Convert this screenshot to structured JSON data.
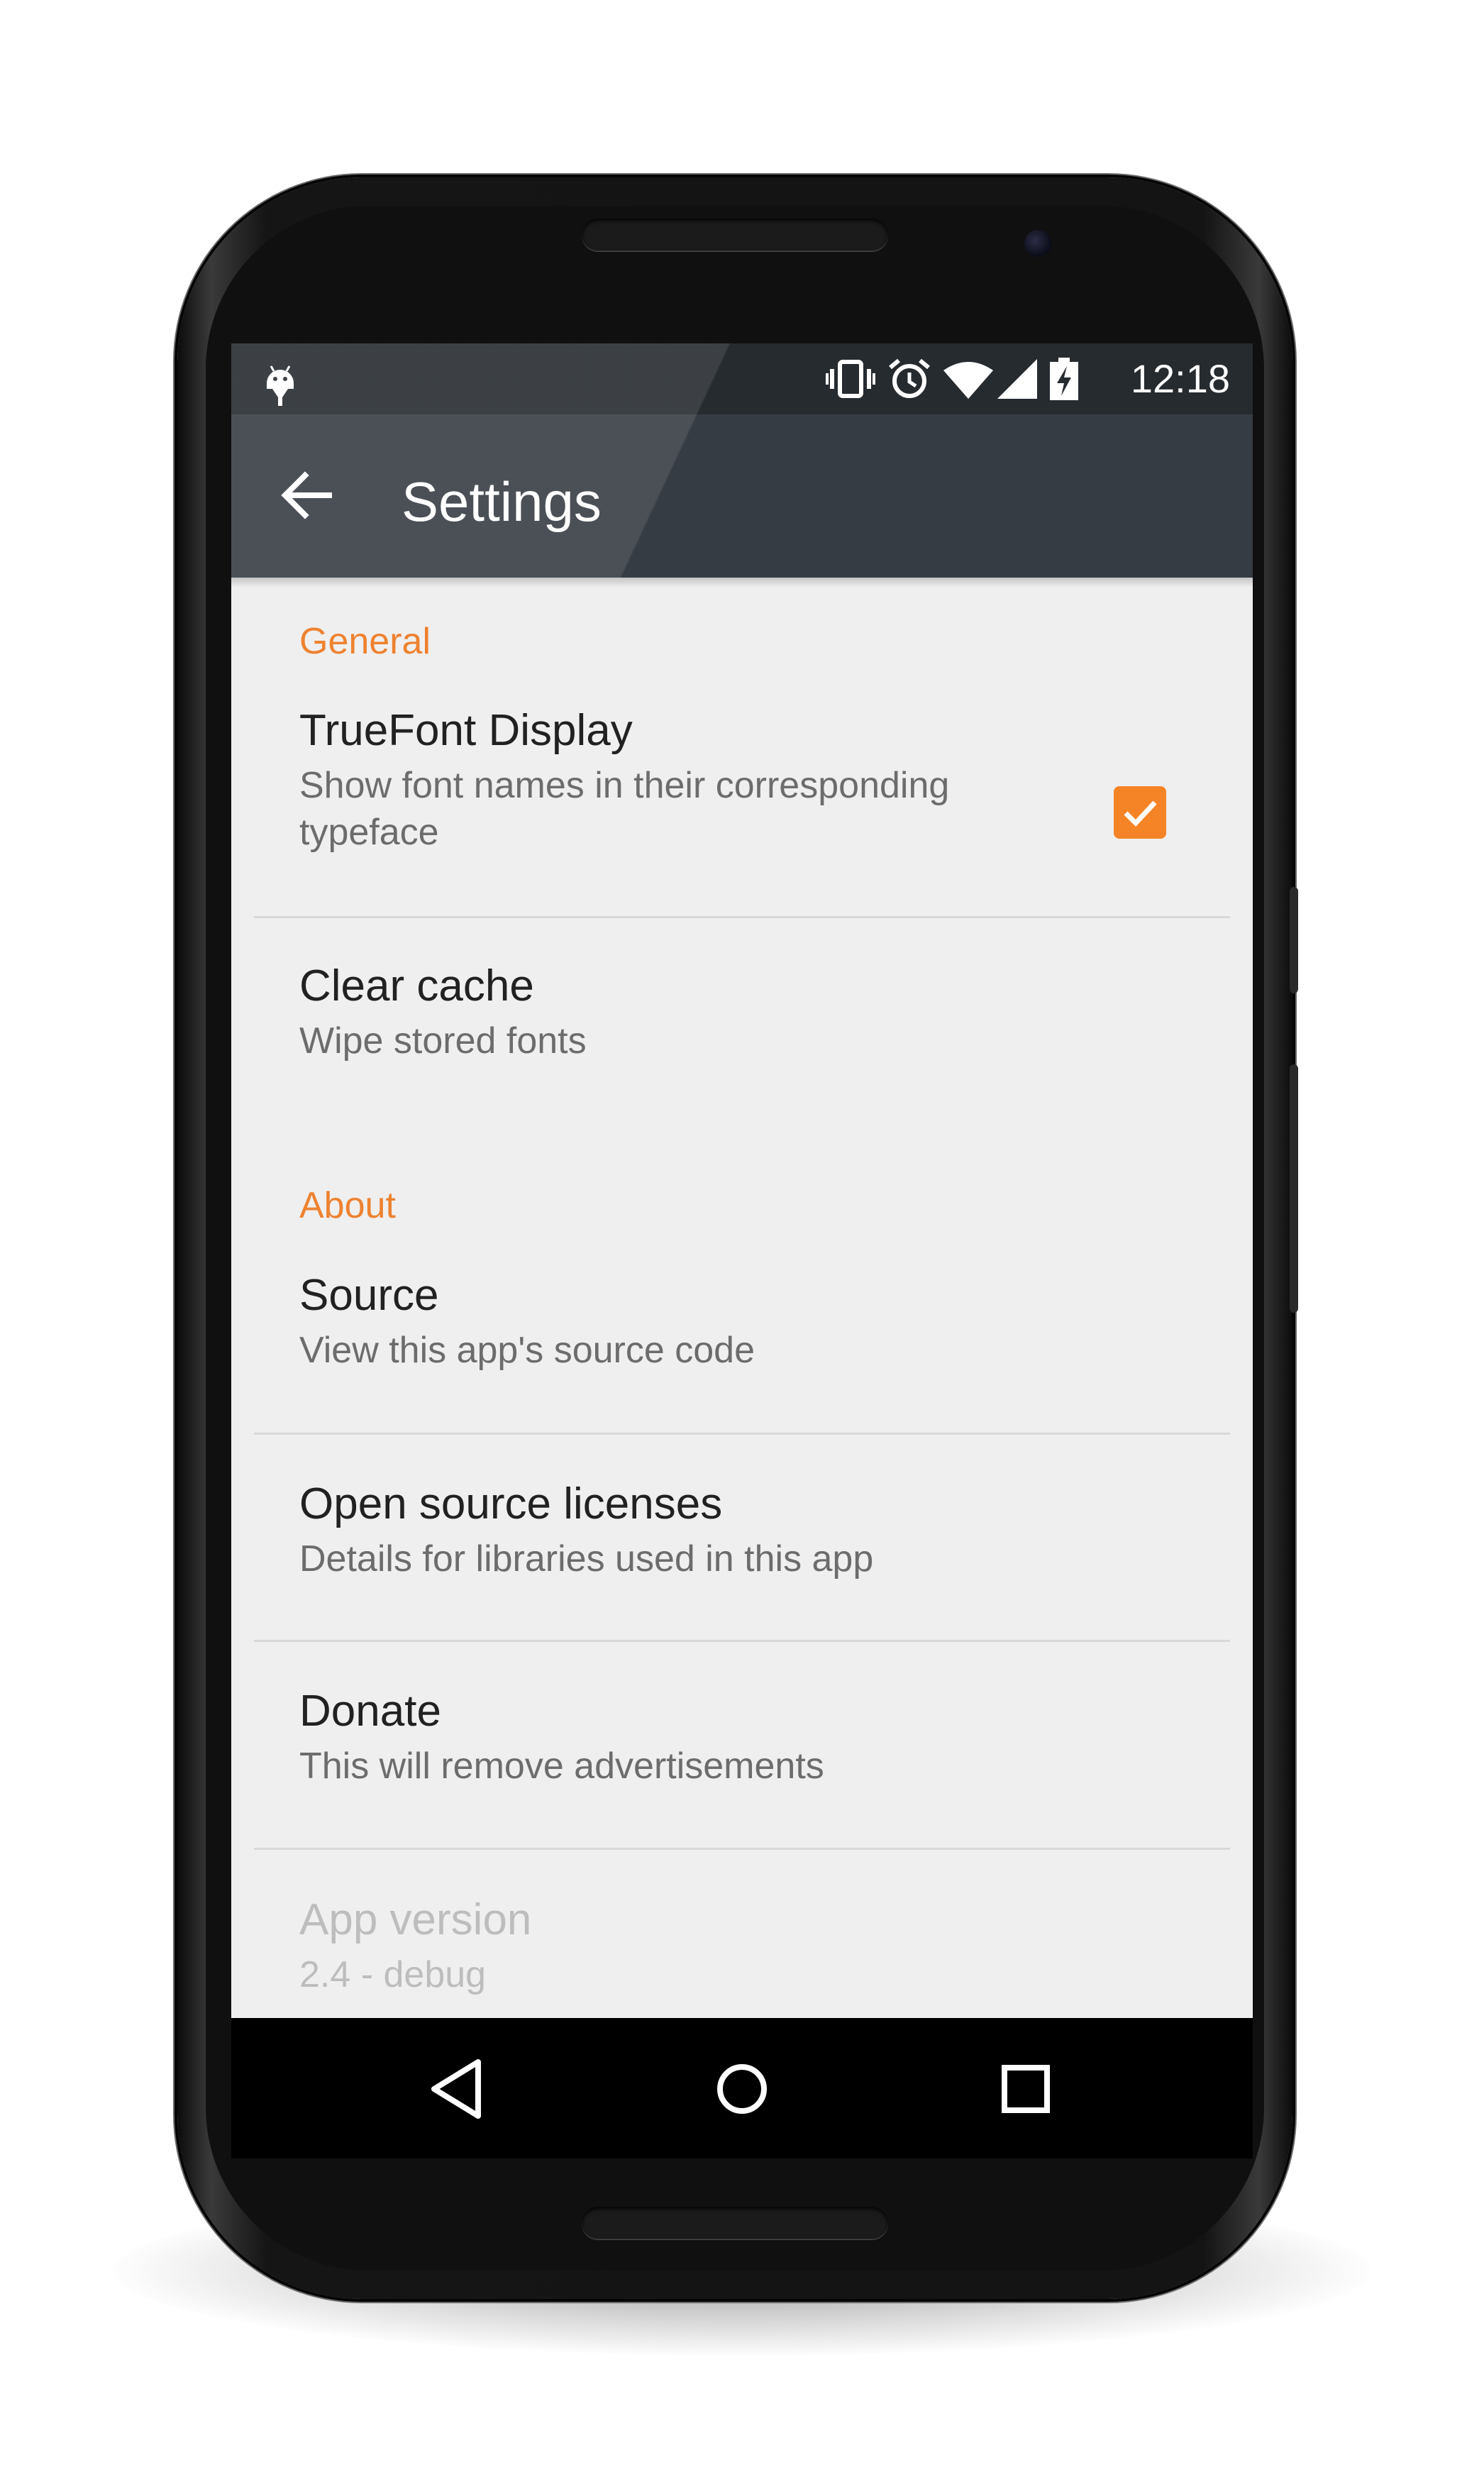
{
  "status_bar": {
    "time": "12:18",
    "icons": [
      "android-debug-icon",
      "vibrate-icon",
      "alarm-icon",
      "wifi-icon",
      "cell-signal-icon",
      "battery-charging-icon"
    ]
  },
  "toolbar": {
    "title": "Settings",
    "back_icon": "arrow-back-icon"
  },
  "settings": {
    "general_header": "General",
    "truefont": {
      "title": "TrueFont Display",
      "summary": "Show font names in their corresponding typeface",
      "checked": true
    },
    "clear_cache": {
      "title": "Clear cache",
      "summary": "Wipe stored fonts"
    },
    "about_header": "About",
    "source": {
      "title": "Source",
      "summary": "View this app's source code"
    },
    "licenses": {
      "title": "Open source licenses",
      "summary": "Details for libraries used in this app"
    },
    "donate": {
      "title": "Donate",
      "summary": "This will remove advertisements"
    },
    "app_version": {
      "title": "App version",
      "summary": "2.4 - debug"
    }
  },
  "nav_bar": {
    "buttons": [
      "back-triangle-icon",
      "home-circle-icon",
      "recents-square-icon"
    ]
  },
  "colors": {
    "accent": "#ee8230",
    "toolbar": "#363c43",
    "status_bar": "#262b30",
    "background": "#efefef"
  }
}
